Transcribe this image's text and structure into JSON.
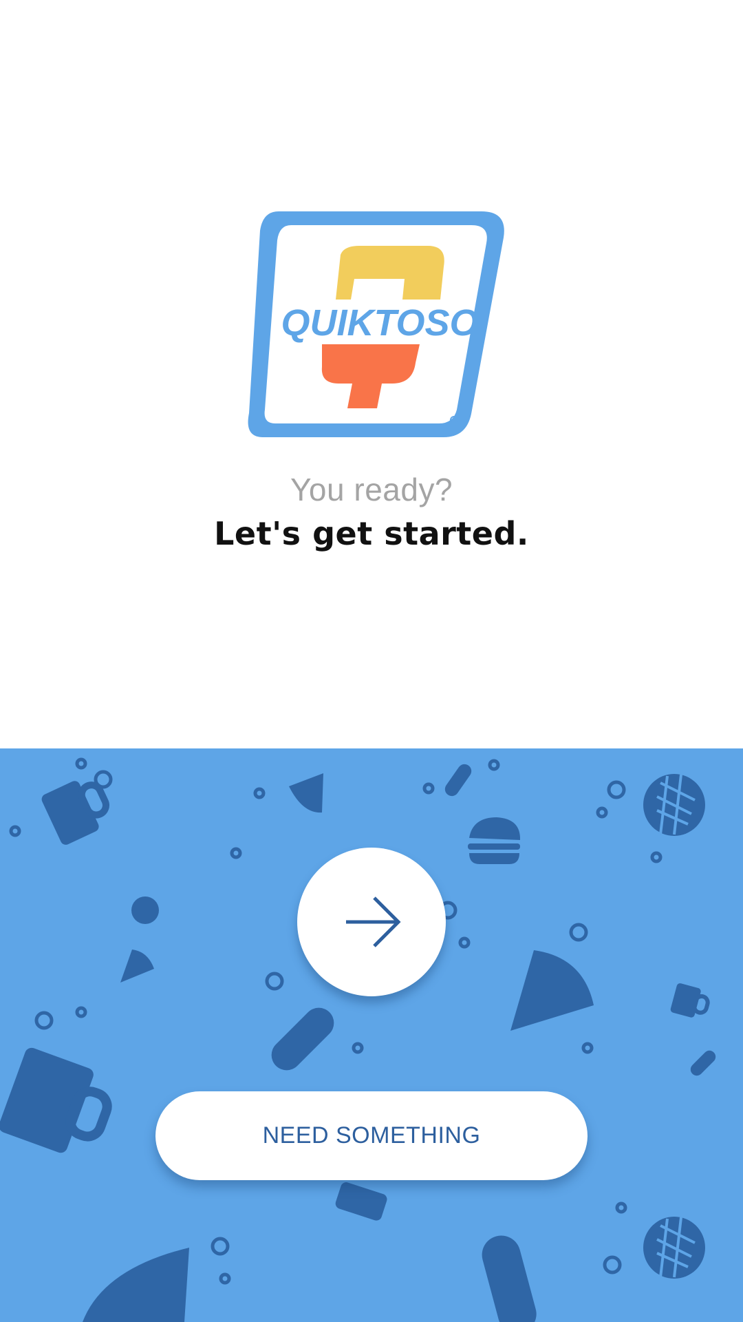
{
  "brand": {
    "logo_text": "QUIKTOSO",
    "colors": {
      "blue": "#5ea5e7",
      "yellow": "#f2cd5c",
      "orange": "#f97449",
      "dark_blue": "#2d5f9e"
    }
  },
  "onboarding": {
    "tagline": "You ready?",
    "headline": "Let's get started."
  },
  "actions": {
    "next_icon": "arrow-right-icon",
    "need_label": "NEED SOMETHING"
  },
  "background": {
    "pattern_icons": [
      "beer-mug-icon",
      "pizza-slice-icon",
      "hotdog-icon",
      "burger-icon",
      "waffle-icon",
      "bubble-icon"
    ]
  }
}
